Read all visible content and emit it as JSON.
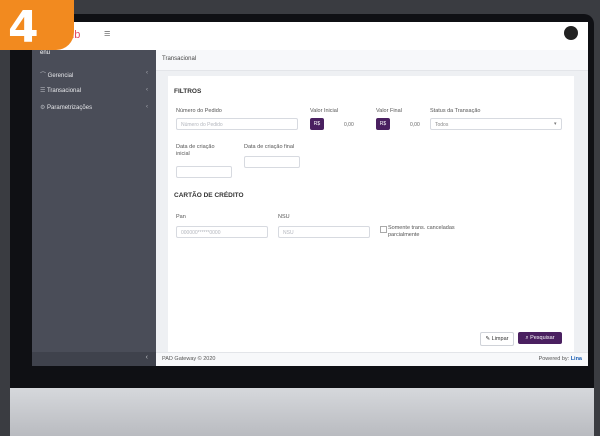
{
  "badge": {
    "number": "4"
  },
  "app": {
    "logo_text": "hub",
    "menu_icon": "≡"
  },
  "sidebar": {
    "title": "enu",
    "items": [
      {
        "label": "Gerencial",
        "icon": "chart-icon"
      },
      {
        "label": "Transacional",
        "icon": "list-icon"
      },
      {
        "label": "Parametrizações",
        "icon": "gear-icon"
      }
    ],
    "collapse": "‹"
  },
  "breadcrumb": "Transacional",
  "filtros": {
    "heading": "FILTROS",
    "pedido": {
      "label": "Número do Pedido",
      "placeholder": "Número do Pedido"
    },
    "valor_inicial": {
      "label": "Valor Inicial",
      "currency": "R$",
      "value": "0,00"
    },
    "valor_final": {
      "label": "Valor Final",
      "currency": "R$",
      "value": "0,00"
    },
    "status": {
      "label": "Status da Transação",
      "value": "Todos"
    },
    "data_inicial": {
      "label": "Data de criação inicial"
    },
    "data_final": {
      "label": "Data de criação final"
    }
  },
  "cartao": {
    "heading": "CARTÃO DE CRÉDITO",
    "pan": {
      "label": "Pan",
      "placeholder": "000000******0000"
    },
    "nsu": {
      "label": "NSU",
      "placeholder": "NSU"
    },
    "somente": "Somente trans. canceladas parcialmente"
  },
  "actions": {
    "limpar": "Limpar",
    "pesquisar": "Pesquisar"
  },
  "footer": {
    "left": "PAD Gateway © 2020",
    "powered_prefix": "Powered by:",
    "powered_brand": "Lina"
  }
}
